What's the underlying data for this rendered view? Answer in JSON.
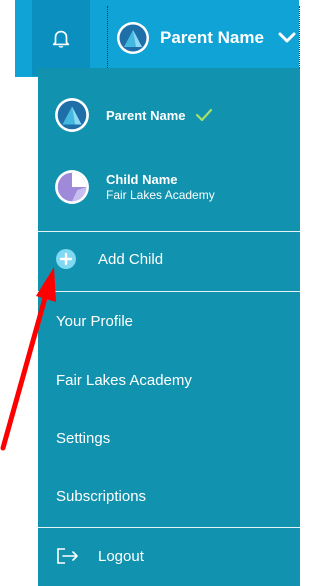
{
  "header": {
    "user_name": "Parent Name",
    "bell_icon": "bell-icon",
    "dropdown_icon": "chevron-down-icon",
    "colors": {
      "bar": "#0fa3d6",
      "bell_bg": "#0a8fbf"
    }
  },
  "menu": {
    "accounts": [
      {
        "name": "Parent Name",
        "selected": true
      },
      {
        "name": "Child Name",
        "school": "Fair Lakes Academy"
      }
    ],
    "add_child_label": "Add Child",
    "items": [
      "Your Profile",
      "Fair Lakes Academy",
      "Settings",
      "Subscriptions"
    ],
    "logout_label": "Logout",
    "colors": {
      "menu_bg": "#1193af",
      "check": "#a7e06a",
      "arrow": "#ff0000"
    }
  }
}
